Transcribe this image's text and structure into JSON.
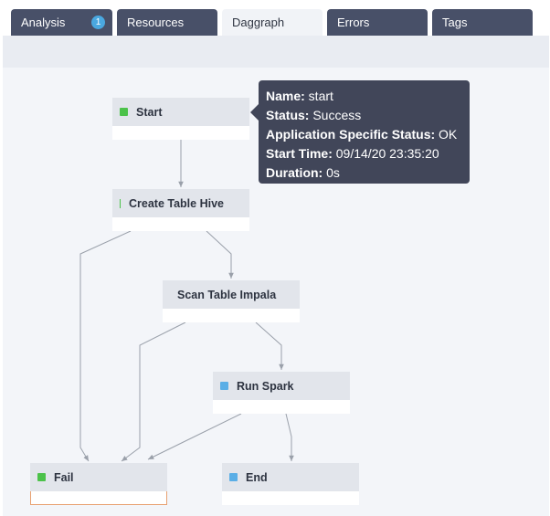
{
  "tabs": [
    {
      "label": "Analysis",
      "badge": "1"
    },
    {
      "label": "Resources"
    },
    {
      "label": "Daggraph",
      "active": true
    },
    {
      "label": "Errors"
    },
    {
      "label": "Tags"
    }
  ],
  "nodes": {
    "start": {
      "label": "Start",
      "status_color": "#4cc24a"
    },
    "create_table_hive": {
      "label": "Create Table Hive",
      "status_color": "#4cc24a"
    },
    "scan_table_impala": {
      "label": "Scan Table Impala"
    },
    "run_spark": {
      "label": "Run Spark",
      "status_color": "#5aaee6"
    },
    "fail": {
      "label": "Fail",
      "status_color": "#4cc24a"
    },
    "end": {
      "label": "End",
      "status_color": "#5aaee6"
    }
  },
  "tooltip": {
    "name_label": "Name:",
    "name_value": " start",
    "status_label": "Status:",
    "status_value": " Success",
    "app_status_label": "Application Specific Status:",
    "app_status_value": " OK",
    "start_time_label": "Start Time:",
    "start_time_value": " 09/14/20 23:35:20",
    "duration_label": "Duration:",
    "duration_value": " 0s"
  }
}
